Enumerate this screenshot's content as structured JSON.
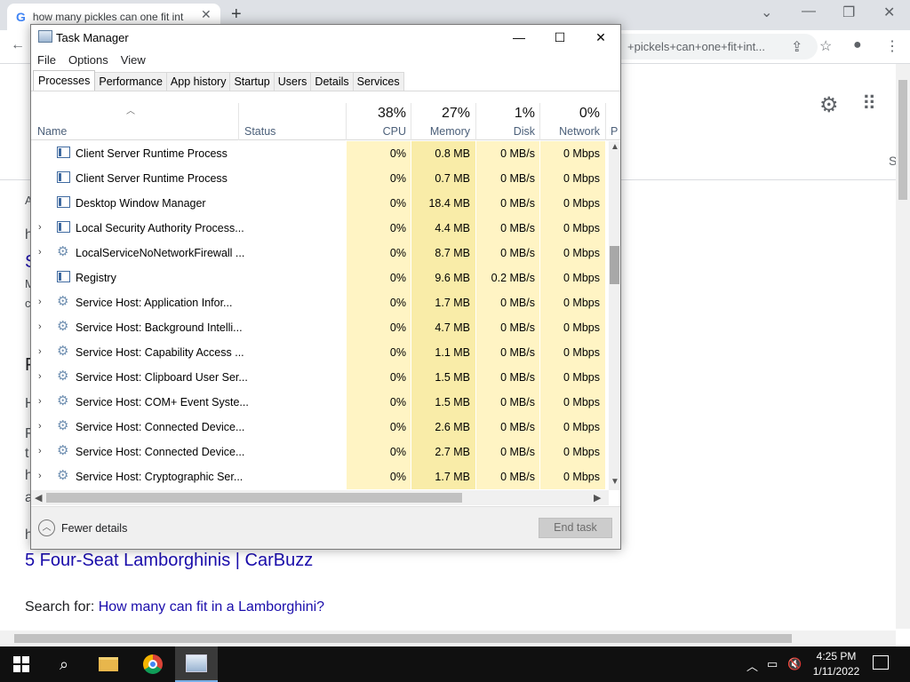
{
  "browser": {
    "tab_title": "how many pickles can one fit int",
    "tab_favicon": "G",
    "url": "+pickels+can+one+fit+int...",
    "page_link_result": "5 Four-Seat Lamborghinis | CarBuzz",
    "search_for_label": "Search for:",
    "search_for_link": "How many can fit in a Lamborghini?",
    "page_fragments": [
      "A",
      "h",
      "S",
      "M",
      "c",
      "F",
      "H",
      "F",
      "t",
      "h",
      "a",
      "h",
      "S"
    ]
  },
  "taskmanager": {
    "title": "Task Manager",
    "menu": [
      "File",
      "Options",
      "View"
    ],
    "tabs": [
      "Processes",
      "Performance",
      "App history",
      "Startup",
      "Users",
      "Details",
      "Services"
    ],
    "active_tab": "Processes",
    "columns": {
      "name": "Name",
      "status": "Status",
      "cpu": {
        "percent": "38%",
        "label": "CPU"
      },
      "memory": {
        "percent": "27%",
        "label": "Memory"
      },
      "disk": {
        "percent": "1%",
        "label": "Disk"
      },
      "network": {
        "percent": "0%",
        "label": "Network"
      },
      "power": "P"
    },
    "processes": [
      {
        "name": "Client Server Runtime Process",
        "expandable": false,
        "icon": "window-icon",
        "cpu": "0%",
        "memory": "0.8 MB",
        "disk": "0 MB/s",
        "network": "0 Mbps"
      },
      {
        "name": "Client Server Runtime Process",
        "expandable": false,
        "icon": "window-icon",
        "cpu": "0%",
        "memory": "0.7 MB",
        "disk": "0 MB/s",
        "network": "0 Mbps"
      },
      {
        "name": "Desktop Window Manager",
        "expandable": false,
        "icon": "window-icon",
        "cpu": "0%",
        "memory": "18.4 MB",
        "disk": "0 MB/s",
        "network": "0 Mbps"
      },
      {
        "name": "Local Security Authority Process...",
        "expandable": true,
        "icon": "window-icon",
        "cpu": "0%",
        "memory": "4.4 MB",
        "disk": "0 MB/s",
        "network": "0 Mbps"
      },
      {
        "name": "LocalServiceNoNetworkFirewall ...",
        "expandable": true,
        "icon": "gear-icon",
        "cpu": "0%",
        "memory": "8.7 MB",
        "disk": "0 MB/s",
        "network": "0 Mbps"
      },
      {
        "name": "Registry",
        "expandable": false,
        "icon": "window-icon",
        "cpu": "0%",
        "memory": "9.6 MB",
        "disk": "0.2 MB/s",
        "network": "0 Mbps"
      },
      {
        "name": "Service Host: Application Infor...",
        "expandable": true,
        "icon": "gear-icon",
        "cpu": "0%",
        "memory": "1.7 MB",
        "disk": "0 MB/s",
        "network": "0 Mbps"
      },
      {
        "name": "Service Host: Background Intelli...",
        "expandable": true,
        "icon": "gear-icon",
        "cpu": "0%",
        "memory": "4.7 MB",
        "disk": "0 MB/s",
        "network": "0 Mbps"
      },
      {
        "name": "Service Host: Capability Access ...",
        "expandable": true,
        "icon": "gear-icon",
        "cpu": "0%",
        "memory": "1.1 MB",
        "disk": "0 MB/s",
        "network": "0 Mbps"
      },
      {
        "name": "Service Host: Clipboard User Ser...",
        "expandable": true,
        "icon": "gear-icon",
        "cpu": "0%",
        "memory": "1.5 MB",
        "disk": "0 MB/s",
        "network": "0 Mbps"
      },
      {
        "name": "Service Host: COM+ Event Syste...",
        "expandable": true,
        "icon": "gear-icon",
        "cpu": "0%",
        "memory": "1.5 MB",
        "disk": "0 MB/s",
        "network": "0 Mbps"
      },
      {
        "name": "Service Host: Connected Device...",
        "expandable": true,
        "icon": "gear-icon",
        "cpu": "0%",
        "memory": "2.6 MB",
        "disk": "0 MB/s",
        "network": "0 Mbps"
      },
      {
        "name": "Service Host: Connected Device...",
        "expandable": true,
        "icon": "gear-icon",
        "cpu": "0%",
        "memory": "2.7 MB",
        "disk": "0 MB/s",
        "network": "0 Mbps"
      },
      {
        "name": "Service Host: Cryptographic Ser...",
        "expandable": true,
        "icon": "gear-icon",
        "cpu": "0%",
        "memory": "1.7 MB",
        "disk": "0 MB/s",
        "network": "0 Mbps"
      }
    ],
    "footer": {
      "fewer_details": "Fewer details",
      "end_task": "End task"
    }
  },
  "taskbar": {
    "time": "4:25 PM",
    "date": "1/11/2022"
  },
  "colors": {
    "cpu_highlight": "#fff4c4",
    "memory_highlight": "#f9eca8",
    "link": "#1a0dab",
    "taskbar": "#101010"
  }
}
